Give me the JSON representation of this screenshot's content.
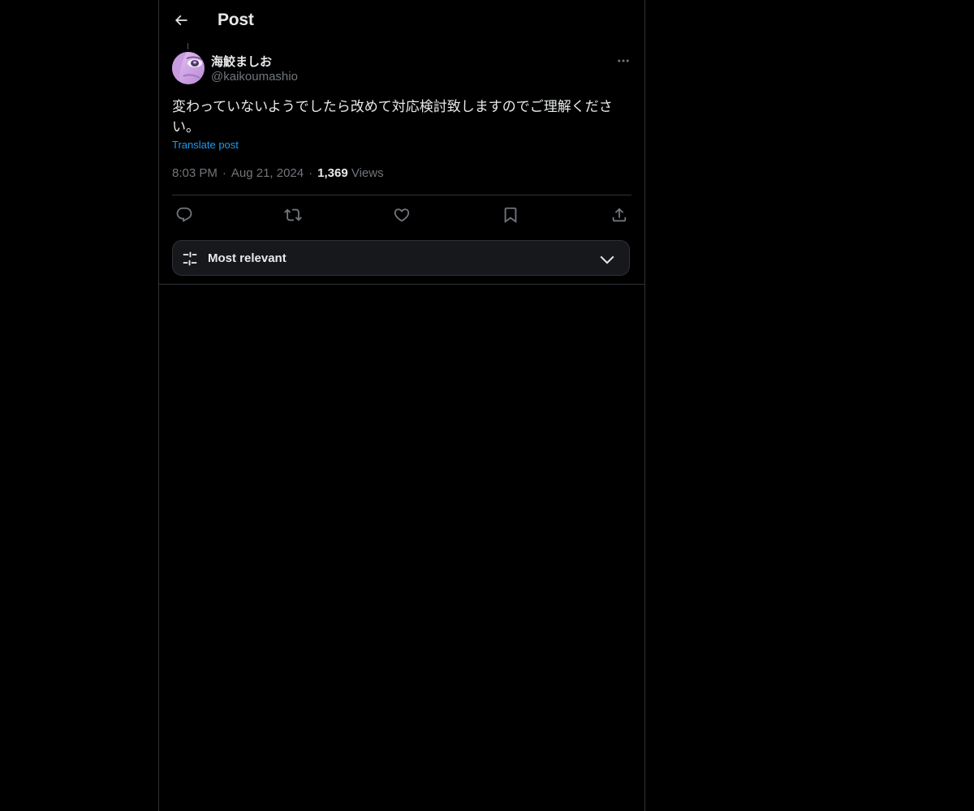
{
  "header": {
    "title": "Post",
    "back_icon": "arrow-left-icon"
  },
  "author": {
    "display_name": "海鮫ましお",
    "handle": "@kaikoumashio"
  },
  "post": {
    "text": "変わっていないようでしたら改めて対応検討致しますのでご理解ください。",
    "translate_label": "Translate post",
    "time": "8:03 PM",
    "separator": "·",
    "date": "Aug 21, 2024",
    "views_count": "1,369",
    "views_label": "Views"
  },
  "actions": {
    "reply_icon": "reply-icon",
    "repost_icon": "repost-icon",
    "like_icon": "heart-icon",
    "bookmark_icon": "bookmark-icon",
    "share_icon": "share-icon"
  },
  "replies_sort": {
    "label": "Most relevant",
    "icon": "sliders-icon",
    "chevron": "chevron-down-icon"
  },
  "colors": {
    "background": "#000000",
    "text_primary": "#e7e9ea",
    "text_secondary": "#71767b",
    "link": "#1d9bf0",
    "border": "#2f3336"
  }
}
